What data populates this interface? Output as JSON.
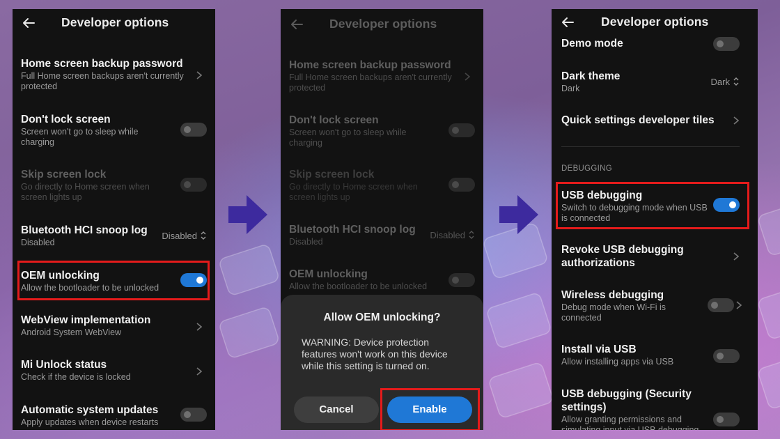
{
  "colors": {
    "accent": "#1f78d6",
    "highlight": "#e41b1b",
    "arrow": "#3d2a9e",
    "panel": "#121212"
  },
  "phone1": {
    "title": "Developer options",
    "items": [
      {
        "title": "Home screen backup password",
        "subtitle": "Full Home screen backups aren't currently protected"
      },
      {
        "title": "Don't lock screen",
        "subtitle": "Screen won't go to sleep while charging"
      },
      {
        "title": "Skip screen lock",
        "subtitle": "Go directly to Home screen when screen lights up"
      },
      {
        "title": "Bluetooth HCI snoop log",
        "subtitle": "Disabled",
        "value": "Disabled"
      },
      {
        "title": "OEM unlocking",
        "subtitle": "Allow the bootloader to be unlocked"
      },
      {
        "title": "WebView implementation",
        "subtitle": "Android System WebView"
      },
      {
        "title": "Mi Unlock status",
        "subtitle": "Check if the device is locked"
      },
      {
        "title": "Automatic system updates",
        "subtitle": "Apply updates when device restarts"
      }
    ]
  },
  "phone2": {
    "title": "Developer options",
    "items": [
      {
        "title": "Home screen backup password",
        "subtitle": "Full Home screen backups aren't currently protected"
      },
      {
        "title": "Don't lock screen",
        "subtitle": "Screen won't go to sleep while charging"
      },
      {
        "title": "Skip screen lock",
        "subtitle": "Go directly to Home screen when screen lights up"
      },
      {
        "title": "Bluetooth HCI snoop log",
        "subtitle": "Disabled",
        "value": "Disabled"
      },
      {
        "title": "OEM unlocking",
        "subtitle": "Allow the bootloader to be unlocked"
      }
    ],
    "dialog": {
      "title": "Allow OEM unlocking?",
      "message": "WARNING: Device protection features won't work on this device while this setting is turned on.",
      "cancel": "Cancel",
      "enable": "Enable"
    }
  },
  "phone3": {
    "title": "Developer options",
    "items": [
      {
        "title": "Demo mode"
      },
      {
        "title": "Dark theme",
        "subtitle": "Dark",
        "value": "Dark"
      },
      {
        "title": "Quick settings developer tiles"
      },
      {
        "title": "USB debugging",
        "subtitle": "Switch to debugging mode when USB is connected"
      },
      {
        "title": "Revoke USB debugging authorizations"
      },
      {
        "title": "Wireless debugging",
        "subtitle": "Debug mode when Wi-Fi is connected"
      },
      {
        "title": "Install via USB",
        "subtitle": "Allow installing apps via USB"
      },
      {
        "title": "USB debugging (Security settings)",
        "subtitle": "Allow granting permissions and simulating input via USB debugging"
      }
    ],
    "section": "DEBUGGING"
  }
}
